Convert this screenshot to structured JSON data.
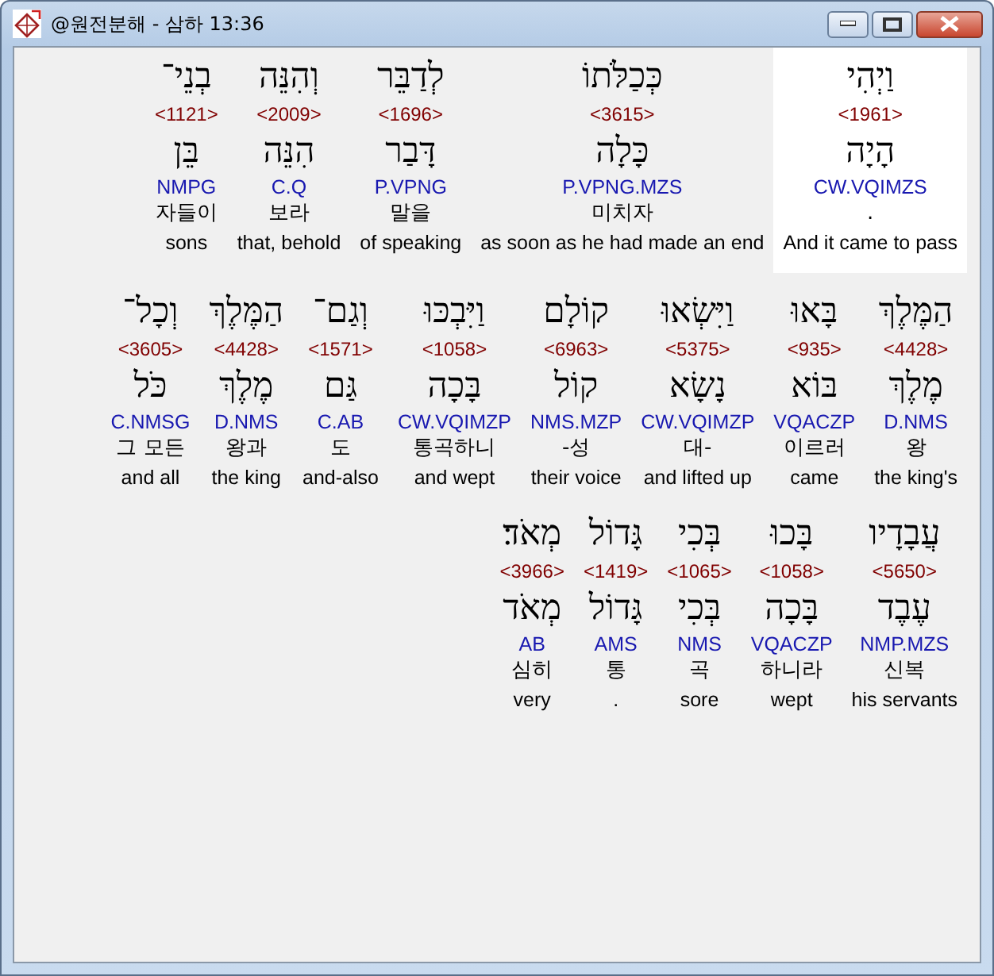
{
  "window": {
    "title": "@원전분해 - 삼하 13:36"
  },
  "lines": [
    [
      {
        "hebrew": "וַיְהִי",
        "strong": "<1961>",
        "lemma": "הָיָה",
        "parse": "CW.VQIMZS",
        "korean": ".",
        "english": "And it came to pass",
        "selected": true
      },
      {
        "hebrew": "כְּכַלֹּתוֹ",
        "strong": "<3615>",
        "lemma": "כָּלָה",
        "parse": "P.VPNG.MZS",
        "korean": "미치자",
        "english": "as soon as he had made an end",
        "selected": false
      },
      {
        "hebrew": "לְדַבֵּר",
        "strong": "<1696>",
        "lemma": "דָּבַר",
        "parse": "P.VPNG",
        "korean": "말을",
        "english": "of speaking",
        "selected": false
      },
      {
        "hebrew": "וְהִנֵּה",
        "strong": "<2009>",
        "lemma": "הִנֵּה",
        "parse": "C.Q",
        "korean": "보라",
        "english": "that, behold",
        "selected": false
      },
      {
        "hebrew": "בְנֵי־",
        "strong": "<1121>",
        "lemma": "בֵּן",
        "parse": "NMPG",
        "korean": "자들이",
        "english": "sons",
        "selected": false
      }
    ],
    [
      {
        "hebrew": "הַמֶּלֶךְ",
        "strong": "<4428>",
        "lemma": "מֶלֶךְ",
        "parse": "D.NMS",
        "korean": "왕",
        "english": "the king's",
        "selected": false
      },
      {
        "hebrew": "בָּאוּ",
        "strong": "<935>",
        "lemma": "בּוֹא",
        "parse": "VQACZP",
        "korean": "이르러",
        "english": "came",
        "selected": false
      },
      {
        "hebrew": "וַיִּשְׂאוּ",
        "strong": "<5375>",
        "lemma": "נָשָׂא",
        "parse": "CW.VQIMZP",
        "korean": "대-",
        "english": "and lifted up",
        "selected": false
      },
      {
        "hebrew": "קוֹלָם",
        "strong": "<6963>",
        "lemma": "קוֹל",
        "parse": "NMS.MZP",
        "korean": "-성",
        "english": "their voice",
        "selected": false
      },
      {
        "hebrew": "וַיִּבְכּוּ",
        "strong": "<1058>",
        "lemma": "בָּכָה",
        "parse": "CW.VQIMZP",
        "korean": "통곡하니",
        "english": "and wept",
        "selected": false
      },
      {
        "hebrew": "וְגַם־",
        "strong": "<1571>",
        "lemma": "גַּם",
        "parse": "C.AB",
        "korean": "도",
        "english": "and-also",
        "selected": false
      },
      {
        "hebrew": "הַמֶּלֶךְ",
        "strong": "<4428>",
        "lemma": "מֶלֶךְ",
        "parse": "D.NMS",
        "korean": "왕과",
        "english": "the king",
        "selected": false
      },
      {
        "hebrew": "וְכָל־",
        "strong": "<3605>",
        "lemma": "כֹּל",
        "parse": "C.NMSG",
        "korean": "그 모든",
        "english": "and all",
        "selected": false
      }
    ],
    [
      {
        "hebrew": "עֲבָדָיו",
        "strong": "<5650>",
        "lemma": "עֶבֶד",
        "parse": "NMP.MZS",
        "korean": "신복",
        "english": "his servants",
        "selected": false
      },
      {
        "hebrew": "בָּכוּ",
        "strong": "<1058>",
        "lemma": "בָּכָה",
        "parse": "VQACZP",
        "korean": "하니라",
        "english": "wept",
        "selected": false
      },
      {
        "hebrew": "בְּכִי",
        "strong": "<1065>",
        "lemma": "בְּכִי",
        "parse": "NMS",
        "korean": "곡",
        "english": "sore",
        "selected": false
      },
      {
        "hebrew": "גָּדוֹל",
        "strong": "<1419>",
        "lemma": "גָּדוֹל",
        "parse": "AMS",
        "korean": "통",
        "english": ".",
        "selected": false
      },
      {
        "hebrew": "מְאֹד׃",
        "strong": "<3966>",
        "lemma": "מְאֹד",
        "parse": "AB",
        "korean": "심히",
        "english": "very",
        "selected": false
      }
    ]
  ]
}
